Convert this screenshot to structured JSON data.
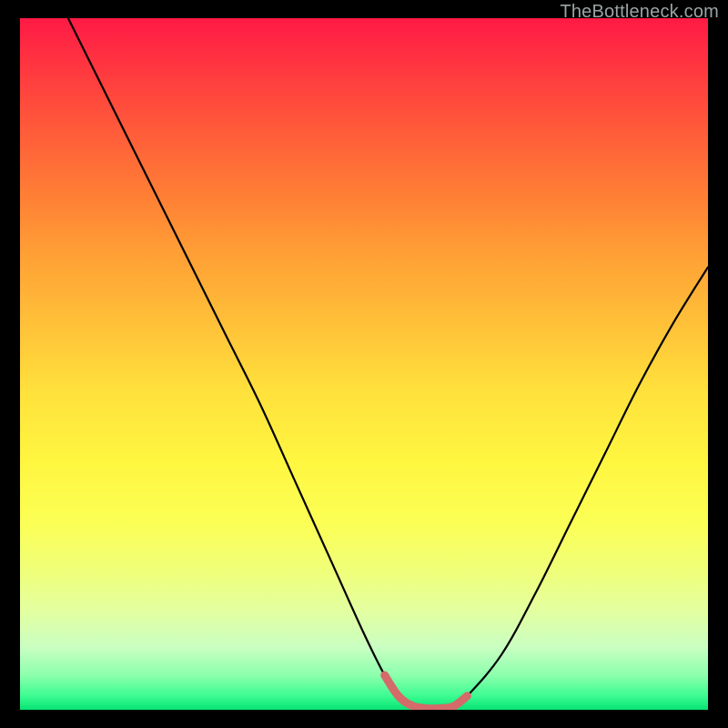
{
  "watermark": "TheBottleneck.com",
  "colors": {
    "background": "#000000",
    "curve": "#000000",
    "trough_marker": "#d46a6a",
    "gradient_top": "#ff1a45",
    "gradient_bottom": "#06e373"
  },
  "chart_data": {
    "type": "line",
    "title": "",
    "xlabel": "",
    "ylabel": "",
    "xlim": [
      0,
      100
    ],
    "ylim": [
      0,
      100
    ],
    "grid": false,
    "legend": false,
    "annotations": [],
    "series": [
      {
        "name": "bottleneck-curve",
        "x": [
          7,
          10,
          15,
          20,
          25,
          30,
          35,
          40,
          45,
          50,
          53,
          55,
          57,
          59,
          61,
          63,
          65,
          70,
          75,
          80,
          85,
          90,
          95,
          100
        ],
        "y": [
          100,
          94,
          84,
          74,
          64,
          54,
          44,
          33,
          22,
          11,
          5,
          2,
          0.6,
          0.2,
          0.2,
          0.5,
          2,
          8,
          17,
          27,
          37,
          47,
          56,
          64
        ]
      },
      {
        "name": "trough-marker",
        "x": [
          53,
          55,
          57,
          59,
          61,
          63,
          65
        ],
        "y": [
          5,
          2,
          0.6,
          0.2,
          0.2,
          0.5,
          2
        ]
      }
    ]
  }
}
